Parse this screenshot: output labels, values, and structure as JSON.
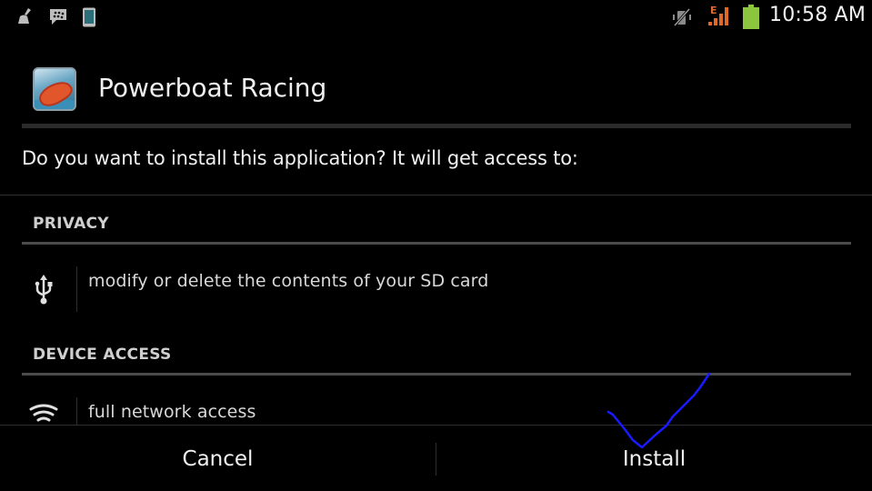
{
  "status_bar": {
    "left_icons": [
      "cleaner-broom-icon",
      "bbm-chat-icon",
      "phone-device-icon"
    ],
    "right_icons": [
      "vibrate-mute-icon",
      "edge-signal-icon",
      "battery-icon"
    ],
    "network_type": "E",
    "time": "10:58 AM",
    "colors": {
      "signal": "#e0692a",
      "battery": "#8cc63f"
    }
  },
  "dialog": {
    "app_name": "Powerboat Racing",
    "question": "Do you want to install this application? It will get access to:",
    "sections": [
      {
        "header": "PRIVACY",
        "permissions": [
          {
            "icon": "usb-storage-icon",
            "label": "modify or delete the contents of your SD card"
          }
        ]
      },
      {
        "header": "DEVICE ACCESS",
        "permissions": [
          {
            "icon": "wifi-network-icon",
            "label": "full network access"
          }
        ]
      }
    ],
    "buttons": {
      "cancel": "Cancel",
      "install": "Install"
    }
  },
  "annotation": {
    "type": "hand-drawn-checkmark",
    "color": "#1a1aff"
  }
}
